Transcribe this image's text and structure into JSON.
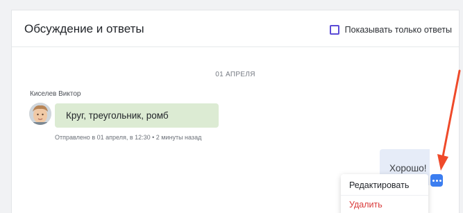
{
  "header": {
    "title": "Обсуждение и ответы",
    "filter_label": "Показывать только ответы"
  },
  "chat": {
    "date_label": "01 АПРЕЛЯ",
    "incoming": {
      "author": "Киселев Виктор",
      "text": "Круг, треугольник, ромб",
      "meta": "Отправлено в 01 апреля, в 12:30 • 2 минуты назад"
    },
    "outgoing": {
      "text": "Хорошо!"
    }
  },
  "context_menu": {
    "edit_label": "Редактировать",
    "delete_label": "Удалить"
  },
  "colors": {
    "accent": "#5b4bd6",
    "incoming_bubble": "#dcebd3",
    "outgoing_bubble": "#e6ecf8",
    "more_button": "#3c7ef0",
    "delete": "#d93a3a",
    "annotation_arrow": "#ef4a2a"
  }
}
